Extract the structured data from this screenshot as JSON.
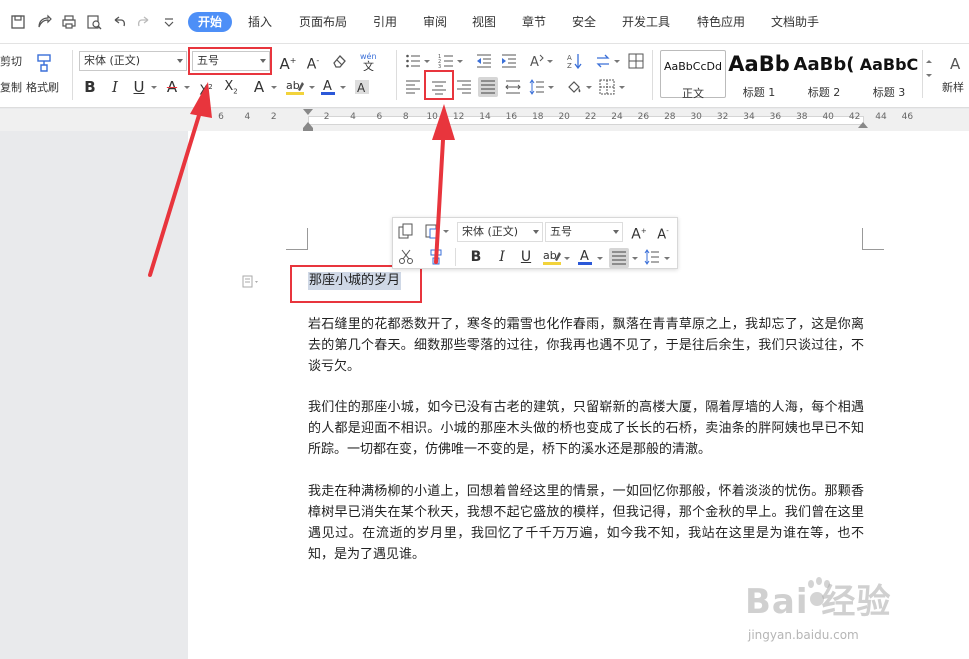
{
  "menubar": {
    "tabs": [
      "开始",
      "插入",
      "页面布局",
      "引用",
      "审阅",
      "视图",
      "章节",
      "安全",
      "开发工具",
      "特色应用",
      "文档助手"
    ],
    "active_tab": "开始",
    "accent_color": "#4d8ff7"
  },
  "ribbon": {
    "cut_label": "剪切",
    "copy_label": "复制",
    "format_painter_label": "格式刷",
    "font_name": "宋体 (正文)",
    "font_size": "五号",
    "styles": [
      {
        "sample": "AaBbCcDd",
        "name": "正文"
      },
      {
        "sample": "AaBb",
        "name": "标题 1"
      },
      {
        "sample": "AaBb(",
        "name": "标题 2"
      },
      {
        "sample": "AaBbC",
        "name": "标题 3"
      }
    ],
    "new_style_label": "新样"
  },
  "ruler": {
    "numbers": [
      "6",
      "4",
      "2",
      "",
      "2",
      "4",
      "6",
      "8",
      "10",
      "12",
      "14",
      "16",
      "18",
      "20",
      "22",
      "24",
      "26",
      "28",
      "30",
      "32",
      "34",
      "36",
      "38",
      "40",
      "42",
      "44",
      "46"
    ]
  },
  "floating_toolbar": {
    "font_name": "宋体 (正文)",
    "font_size": "五号"
  },
  "document": {
    "title": "那座小城的岁月",
    "paragraphs": [
      "岩石缝里的花都悉数开了，寒冬的霜雪也化作春雨，飘落在青青草原之上，我却忘了，这是你离去的第几个春天。细数那些零落的过往，你我再也遇不见了，于是往后余生，我们只谈过往，不谈亏欠。",
      "我们住的那座小城，如今已没有古老的建筑，只留崭新的高楼大厦，隔着厚墙的人海，每个相遇的人都是迎面不相识。小城的那座木头做的桥也变成了长长的石桥，卖油条的胖阿姨也早已不知所踪。一切都在变，仿佛唯一不变的是，桥下的溪水还是那般的清澈。",
      "我走在种满杨柳的小道上，回想着曾经这里的情景，一如回忆你那般，怀着淡淡的忧伤。那颗香樟树早已消失在某个秋天，我想不起它盛放的模样，但我记得，那个金秋的早上。我们曾在这里遇见过。在流逝的岁月里，我回忆了千千万万遍，如今我不知，我站在这里是为谁在等，也不知，是为了遇见谁。"
    ]
  },
  "watermark": {
    "logo": "Bai  经验",
    "url": "jingyan.baidu.com"
  },
  "colors": {
    "highlight_box": "#e8353d",
    "selection": "#cfd8e6",
    "font_color_bar": "#2b58d8",
    "highlight_bar": "#f2d33b"
  }
}
